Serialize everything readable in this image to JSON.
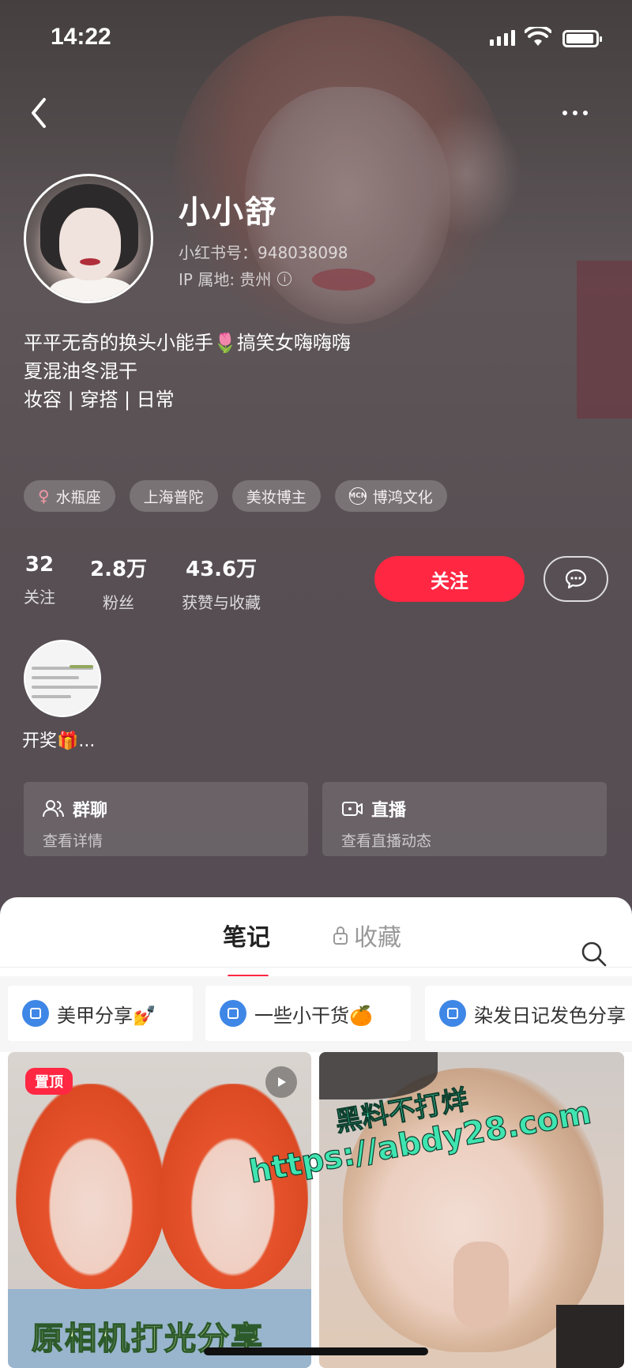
{
  "status_bar": {
    "time": "14:22"
  },
  "profile": {
    "name": "小小舒",
    "red_id": "小红书号：948038098",
    "ip": "IP 属地: 贵州",
    "bio_lines": [
      "平平无奇的换头小能手🌷搞笑女嗨嗨嗨",
      "夏混油冬混干",
      "妆容 | 穿搭 | 日常"
    ],
    "tags": [
      {
        "icon": "venus-icon",
        "label": "水瓶座"
      },
      {
        "label": "上海普陀"
      },
      {
        "label": "美妆博主"
      },
      {
        "icon": "mcn-icon",
        "icon_text": "MCN",
        "label": "博鸿文化"
      }
    ],
    "stats": [
      {
        "value": "32",
        "label": "关注"
      },
      {
        "value": "2.8万",
        "label": "粉丝"
      },
      {
        "value": "43.6万",
        "label": "获赞与收藏"
      }
    ],
    "follow_label": "关注",
    "group_label": "开奖🎁..."
  },
  "cards": [
    {
      "icon": "group-chat-icon",
      "title": "群聊",
      "subtitle": "查看详情"
    },
    {
      "icon": "live-icon",
      "title": "直播",
      "subtitle": "查看直播动态"
    }
  ],
  "tabs": {
    "notes": "笔记",
    "collections": "收藏"
  },
  "albums": [
    "美甲分享💅",
    "一些小干货🍊",
    "染发日记发色分享"
  ],
  "notes": [
    {
      "badge": "置顶",
      "caption": "原相机打光分享"
    }
  ],
  "watermark": {
    "line1": "黑料不打烊",
    "line2": "https://abdy28.com"
  },
  "colors": {
    "accent": "#ff2742",
    "album_icon": "#3f87e6"
  }
}
